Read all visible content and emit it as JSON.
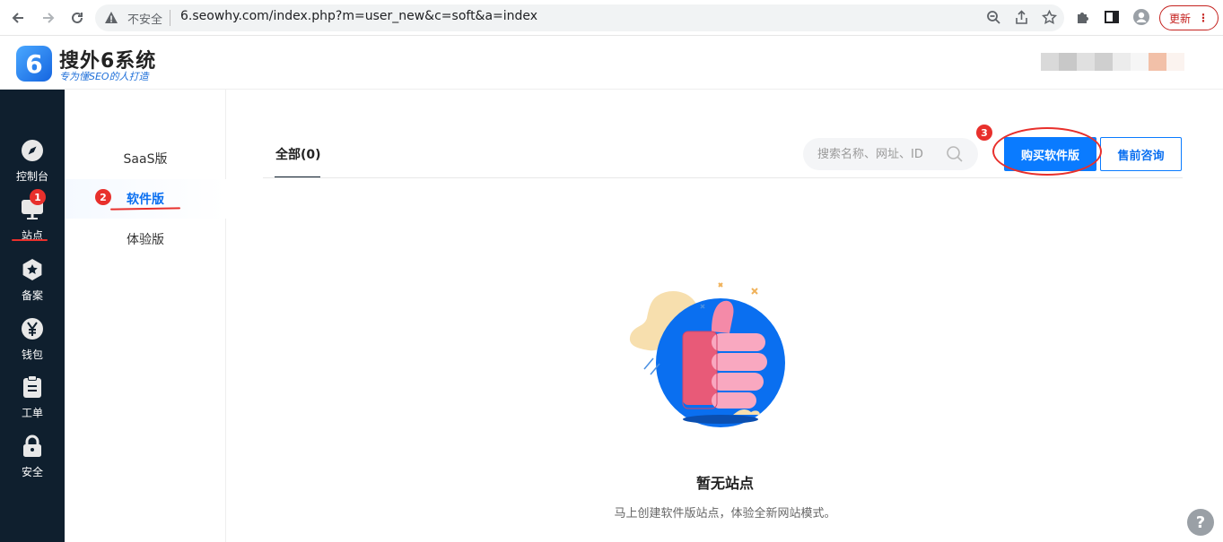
{
  "browser": {
    "insecure_label": "不安全",
    "url": "6.seowhy.com/index.php?m=user_new&c=soft&a=index",
    "update_label": "更新"
  },
  "header": {
    "logo_digit": "6",
    "brand_name": "搜外6系统",
    "slogan": "专为懂SEO的人打造"
  },
  "sidebar": {
    "items": [
      {
        "label": "控制台",
        "icon": "compass-icon"
      },
      {
        "label": "站点",
        "icon": "monitor-icon"
      },
      {
        "label": "备案",
        "icon": "star-badge-icon"
      },
      {
        "label": "钱包",
        "icon": "yen-icon"
      },
      {
        "label": "工单",
        "icon": "clipboard-icon"
      },
      {
        "label": "安全",
        "icon": "lock-icon"
      }
    ]
  },
  "submenu": {
    "items": [
      {
        "label": "SaaS版"
      },
      {
        "label": "软件版"
      },
      {
        "label": "体验版"
      }
    ]
  },
  "main": {
    "tab_all": "全部(0)",
    "search_placeholder": "搜索名称、网址、ID",
    "buy_button": "购买软件版",
    "consult_button": "售前咨询",
    "empty_title": "暂无站点",
    "empty_desc": "马上创建软件版站点，体验全新网站模式。"
  },
  "annotations": {
    "badges": [
      "1",
      "2",
      "3"
    ]
  },
  "help": "?",
  "colors": {
    "sidebar_bg": "#0f1f2e",
    "accent": "#0a7bff",
    "annotation": "#e8302c"
  }
}
